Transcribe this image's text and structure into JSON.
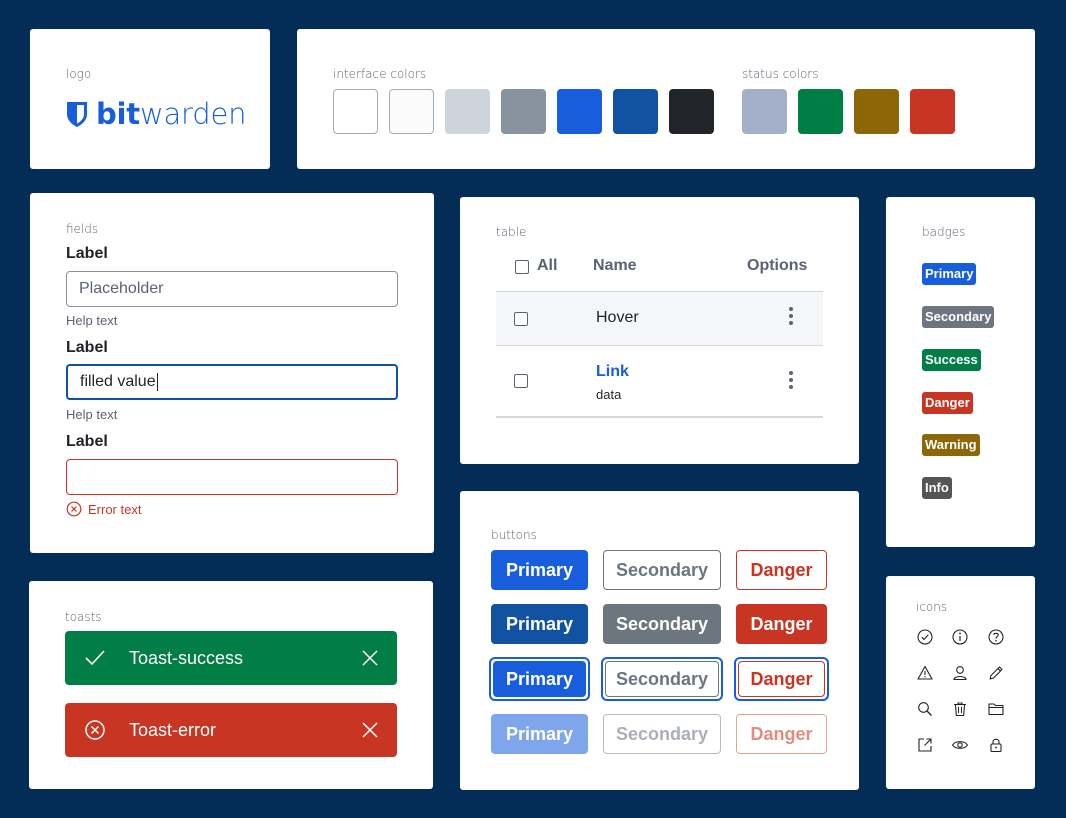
{
  "colors": {
    "background": "#032d57",
    "primary": "#175ddc",
    "primary_dark": "#1252a3",
    "secondary": "#6d757e",
    "success": "#017e45",
    "danger": "#c83522",
    "warning": "#8d6608",
    "info": "#555555"
  },
  "logo": {
    "section_label": "logo",
    "brand_bold": "bit",
    "brand_light": "warden",
    "icon": "shield-icon"
  },
  "interface_colors": {
    "label": "interface colors",
    "swatches": [
      "#ffffff",
      "#fbfbfc",
      "#ced4dc",
      "#89929f",
      "#175ddc",
      "#1252a3",
      "#212529"
    ]
  },
  "status_colors": {
    "label": "status colors",
    "swatches": [
      "#a4b0c9",
      "#017e45",
      "#8d6608",
      "#c83522"
    ]
  },
  "fields": {
    "label": "fields",
    "items": [
      {
        "label": "Label",
        "placeholder": "Placeholder",
        "value": "",
        "help": "Help text",
        "state": "default"
      },
      {
        "label": "Label",
        "placeholder": "",
        "value": "filled value",
        "help": "Help text",
        "state": "focused"
      },
      {
        "label": "Label",
        "placeholder": "",
        "value": "",
        "error": "Error text",
        "state": "error"
      }
    ]
  },
  "table": {
    "label": "table",
    "headers": {
      "select_all": "All",
      "name": "Name",
      "options": "Options"
    },
    "rows": [
      {
        "name": "Hover",
        "state": "hover"
      },
      {
        "link": "Link",
        "sub": "data",
        "state": "default"
      }
    ]
  },
  "badges": {
    "label": "badges",
    "items": [
      {
        "text": "Primary",
        "color": "#175ddc"
      },
      {
        "text": "Secondary",
        "color": "#6d757e"
      },
      {
        "text": "Success",
        "color": "#017e45"
      },
      {
        "text": "Danger",
        "color": "#c83522"
      },
      {
        "text": "Warning",
        "color": "#8d6608"
      },
      {
        "text": "Info",
        "color": "#555555"
      }
    ]
  },
  "buttons": {
    "label": "buttons",
    "rows": [
      {
        "state": "default",
        "primary": "Primary",
        "secondary": "Secondary",
        "danger": "Danger"
      },
      {
        "state": "hover",
        "primary": "Primary",
        "secondary": "Secondary",
        "danger": "Danger"
      },
      {
        "state": "focus",
        "primary": "Primary",
        "secondary": "Secondary",
        "danger": "Danger"
      },
      {
        "state": "disabled",
        "primary": "Primary",
        "secondary": "Secondary",
        "danger": "Danger"
      }
    ]
  },
  "toasts": {
    "label": "toasts",
    "items": [
      {
        "text": "Toast-success",
        "icon": "check-icon",
        "close": "close-icon"
      },
      {
        "text": "Toast-error",
        "icon": "error-circle-icon",
        "close": "close-icon"
      }
    ]
  },
  "icons": {
    "label": "icons",
    "items": [
      "check-circle-icon",
      "info-icon",
      "question-icon",
      "warning-icon",
      "user-icon",
      "pencil-icon",
      "search-icon",
      "trash-icon",
      "folder-icon",
      "external-link-icon",
      "eye-icon",
      "lock-icon"
    ]
  }
}
